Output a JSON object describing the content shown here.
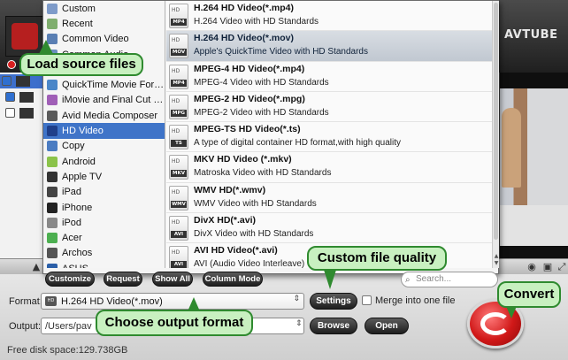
{
  "app": {
    "brand": "AVTUBE"
  },
  "categories": [
    {
      "label": "Custom",
      "icon": "custom-icon",
      "color": "#7e9bc9"
    },
    {
      "label": "Recent",
      "icon": "recent-icon",
      "color": "#7fae6e"
    },
    {
      "label": "Common Video",
      "icon": "common-video-icon",
      "color": "#5a7fb3"
    },
    {
      "label": "Common Audio",
      "icon": "common-audio-icon",
      "color": "#6b8fbf"
    },
    {
      "label": "HD Video",
      "icon": "hd-video-icon",
      "color": "#3f74c8"
    },
    {
      "label": "QuickTime Movie Format",
      "icon": "quicktime-icon",
      "color": "#4a86c8"
    },
    {
      "label": "iMovie and Final Cut Ex...",
      "icon": "imovie-icon",
      "color": "#a05fb7"
    },
    {
      "label": "Avid Media Composer",
      "icon": "avid-icon",
      "color": "#5a5a5a"
    },
    {
      "label": "HD Video",
      "icon": "hd-video-icon",
      "color": "#1f3f8a",
      "selected": true
    },
    {
      "label": "Copy",
      "icon": "copy-icon",
      "color": "#4b7cc2"
    },
    {
      "label": "Android",
      "icon": "android-icon",
      "color": "#8bc34a"
    },
    {
      "label": "Apple TV",
      "icon": "apple-tv-icon",
      "color": "#333333"
    },
    {
      "label": "iPad",
      "icon": "ipad-icon",
      "color": "#444444"
    },
    {
      "label": "iPhone",
      "icon": "iphone-icon",
      "color": "#222222"
    },
    {
      "label": "iPod",
      "icon": "ipod-icon",
      "color": "#888888"
    },
    {
      "label": "Acer",
      "icon": "acer-icon",
      "color": "#4caf50"
    },
    {
      "label": "Archos",
      "icon": "archos-icon",
      "color": "#555555"
    },
    {
      "label": "ASUS",
      "icon": "asus-icon",
      "color": "#2b5fa8"
    }
  ],
  "formats": [
    {
      "name": "H.264 HD Video(*.mp4)",
      "desc": "H.264 Video with HD Standards",
      "tag": "MP4"
    },
    {
      "name": "H.264 HD Video(*.mov)",
      "desc": "Apple's QuickTime Video with HD Standards",
      "tag": "MOV",
      "selected": true
    },
    {
      "name": "MPEG-4 HD Video(*.mp4)",
      "desc": "MPEG-4 Video with HD Standards",
      "tag": "MP4"
    },
    {
      "name": "MPEG-2 HD Video(*.mpg)",
      "desc": "MPEG-2 Video with HD Standards",
      "tag": "MPG"
    },
    {
      "name": "MPEG-TS HD Video(*.ts)",
      "desc": "A type of digital container HD format,with high quality",
      "tag": "TS"
    },
    {
      "name": "MKV HD Video (*.mkv)",
      "desc": "Matroska Video with HD Standards",
      "tag": "MKV"
    },
    {
      "name": "WMV HD(*.wmv)",
      "desc": "WMV Video with HD Standards",
      "tag": "WMV"
    },
    {
      "name": "DivX HD(*.avi)",
      "desc": "DivX Video with HD Standards",
      "tag": "AVI"
    },
    {
      "name": "AVI HD Video(*.avi)",
      "desc": "AVI (Audio Video Interleave) with HD Standards",
      "tag": "AVI"
    }
  ],
  "format_icon_top": "HD",
  "menu_toolbar": {
    "customize": "Customize",
    "request": "Request",
    "show_all": "Show All",
    "column_mode": "Column Mode",
    "search_placeholder": "Search..."
  },
  "bottom": {
    "format_label": "Format:",
    "format_value": "H.264 HD Video(*.mov)",
    "settings": "Settings",
    "merge_label": "Merge into one file",
    "output_label": "Output:",
    "output_path": "/Users/pav",
    "browse": "Browse",
    "open": "Open",
    "disk_space": "Free disk space:129.738GB"
  },
  "callouts": {
    "load": "Load source files",
    "quality": "Custom file quality",
    "format": "Choose output format",
    "convert": "Convert"
  },
  "colors": {
    "callout_fill": "#c8f0c0",
    "callout_border": "#2f8a2f",
    "selection": "#3f74c8",
    "convert_red": "#d01818"
  }
}
